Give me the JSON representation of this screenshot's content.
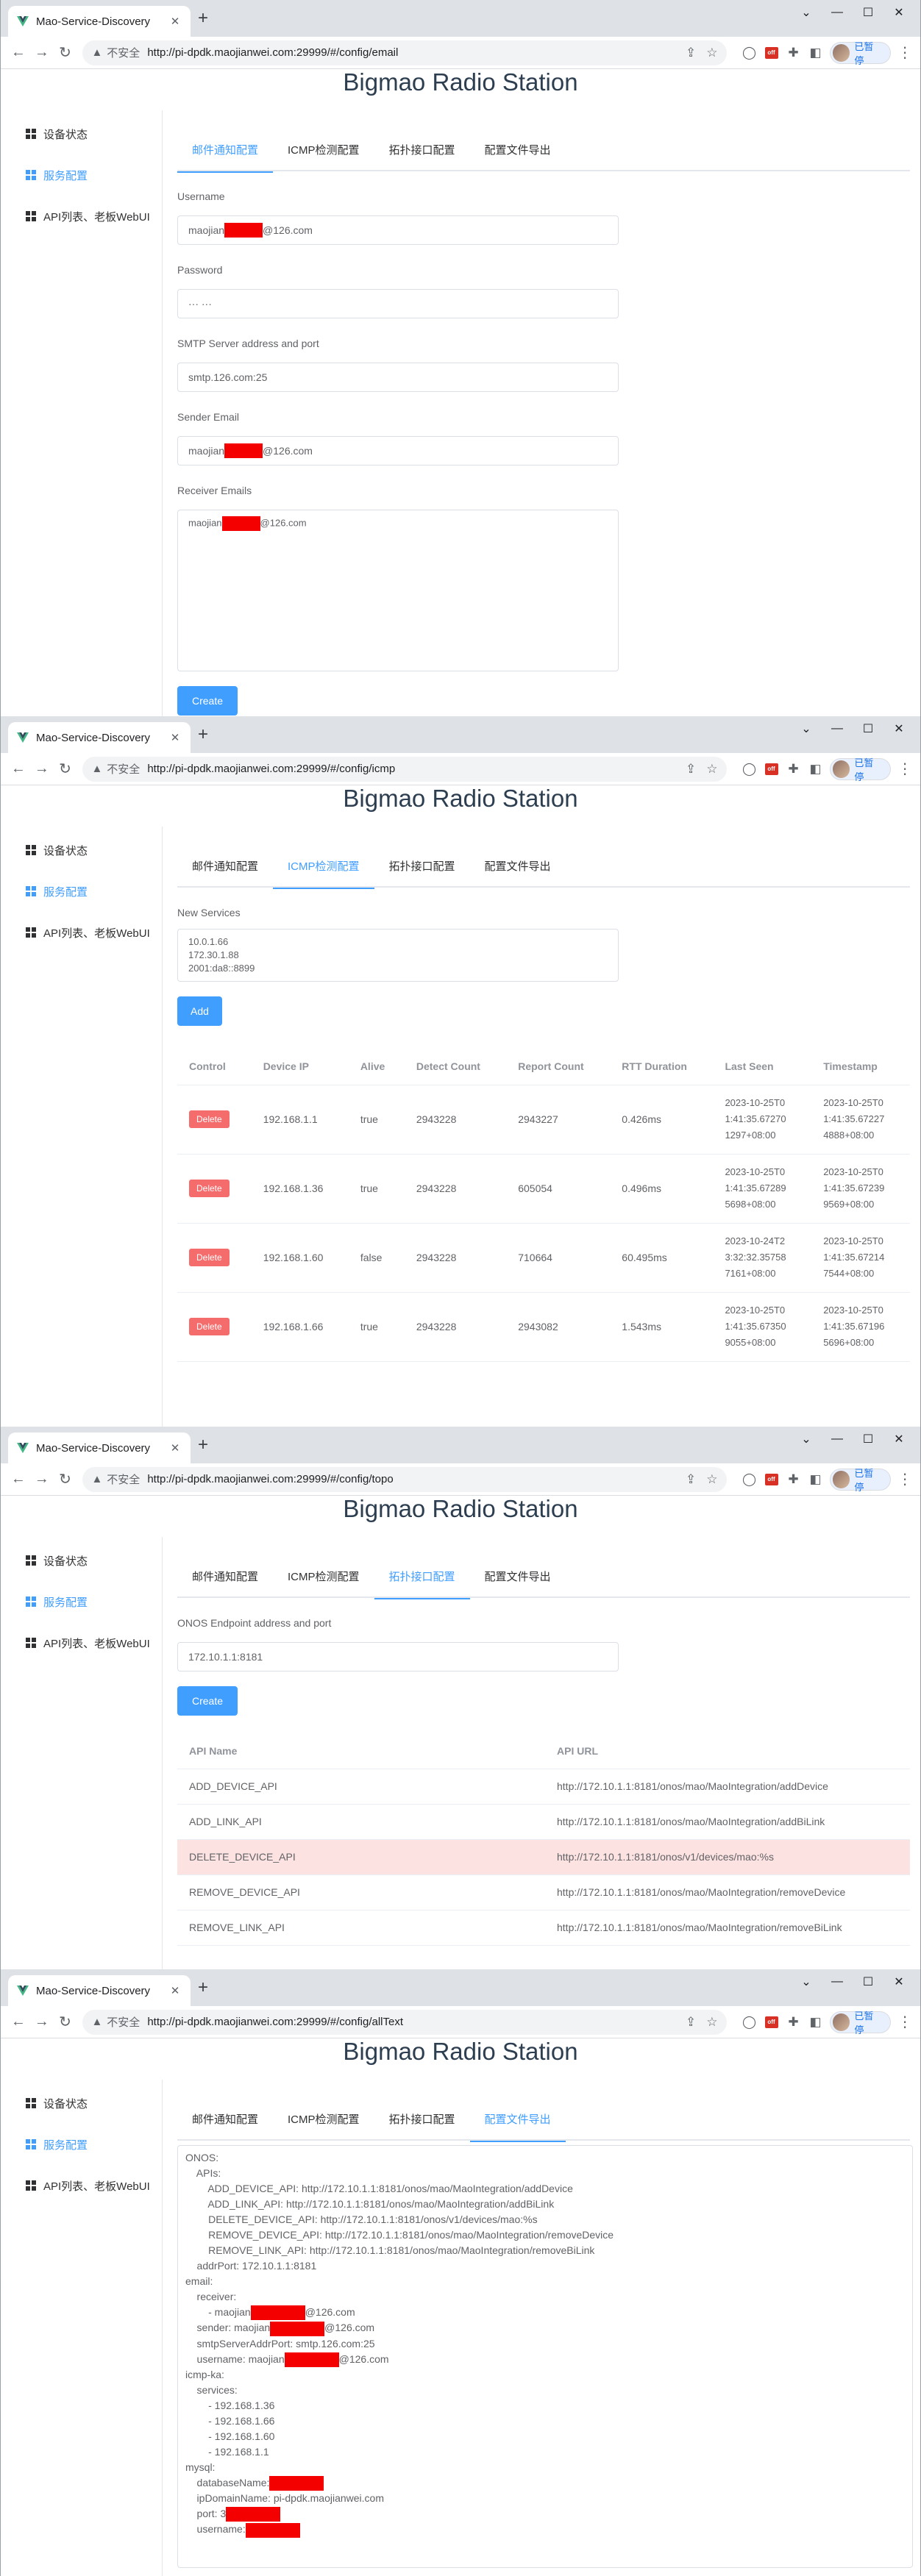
{
  "browser": {
    "tab_title": "Mao-Service-Discovery",
    "insecure_label": "不安全",
    "profile_label": "已暂停",
    "ext_badge": "off"
  },
  "app": {
    "title": "Bigmao Radio Station",
    "menu": [
      "设备状态",
      "服务配置",
      "API列表、老板WebUI"
    ],
    "tabs": [
      "邮件通知配置",
      "ICMP检测配置",
      "拓扑接口配置",
      "配置文件导出"
    ]
  },
  "screens": [
    {
      "url": "http://pi-dpdk.maojianwei.com:29999/#/config/email"
    },
    {
      "url": "http://pi-dpdk.maojianwei.com:29999/#/config/icmp"
    },
    {
      "url": "http://pi-dpdk.maojianwei.com:29999/#/config/topo"
    },
    {
      "url": "http://pi-dpdk.maojianwei.com:29999/#/config/allText"
    }
  ],
  "email": {
    "username_label": "Username",
    "username_prefix": "maojian",
    "username_suffix": "@126.com",
    "password_label": "Password",
    "password_value": "··· ···",
    "smtp_label": "SMTP Server address and port",
    "smtp_value": "smtp.126.com:25",
    "sender_label": "Sender Email",
    "sender_prefix": "maojian",
    "sender_suffix": "@126.com",
    "receivers_label": "Receiver Emails",
    "receivers_prefix": "maojian",
    "receivers_suffix": "@126.com",
    "create_label": "Create"
  },
  "icmp": {
    "new_services_label": "New Services",
    "services_text": "10.0.1.66\n172.30.1.88\n2001:da8::8899",
    "add_label": "Add",
    "delete_label": "Delete",
    "columns": [
      "Control",
      "Device IP",
      "Alive",
      "Detect Count",
      "Report Count",
      "RTT Duration",
      "Last Seen",
      "Timestamp"
    ],
    "rows": [
      {
        "ip": "192.168.1.1",
        "alive": "true",
        "detect": "2943228",
        "report": "2943227",
        "rtt": "0.426ms",
        "last_seen": "2023-10-25T0\n1:41:35.67270\n1297+08:00",
        "timestamp": "2023-10-25T0\n1:41:35.67227\n4888+08:00"
      },
      {
        "ip": "192.168.1.36",
        "alive": "true",
        "detect": "2943228",
        "report": "605054",
        "rtt": "0.496ms",
        "last_seen": "2023-10-25T0\n1:41:35.67289\n5698+08:00",
        "timestamp": "2023-10-25T0\n1:41:35.67239\n9569+08:00"
      },
      {
        "ip": "192.168.1.60",
        "alive": "false",
        "detect": "2943228",
        "report": "710664",
        "rtt": "60.495ms",
        "last_seen": "2023-10-24T2\n3:32:32.35758\n7161+08:00",
        "timestamp": "2023-10-25T0\n1:41:35.67214\n7544+08:00"
      },
      {
        "ip": "192.168.1.66",
        "alive": "true",
        "detect": "2943228",
        "report": "2943082",
        "rtt": "1.543ms",
        "last_seen": "2023-10-25T0\n1:41:35.67350\n9055+08:00",
        "timestamp": "2023-10-25T0\n1:41:35.67196\n5696+08:00"
      }
    ]
  },
  "topo": {
    "endpoint_label": "ONOS Endpoint address and port",
    "endpoint_value": "172.10.1.1:8181",
    "create_label": "Create",
    "columns": [
      "API Name",
      "API URL"
    ],
    "rows": [
      {
        "name": "ADD_DEVICE_API",
        "url": "http://172.10.1.1:8181/onos/mao/MaoIntegration/addDevice"
      },
      {
        "name": "ADD_LINK_API",
        "url": "http://172.10.1.1:8181/onos/mao/MaoIntegration/addBiLink"
      },
      {
        "name": "DELETE_DEVICE_API",
        "url": "http://172.10.1.1:8181/onos/v1/devices/mao:%s"
      },
      {
        "name": "REMOVE_DEVICE_API",
        "url": "http://172.10.1.1:8181/onos/mao/MaoIntegration/removeDevice"
      },
      {
        "name": "REMOVE_LINK_API",
        "url": "http://172.10.1.1:8181/onos/mao/MaoIntegration/removeBiLink"
      }
    ]
  },
  "export": {
    "lines": [
      {
        "t": "ONOS:"
      },
      {
        "t": "    APIs:"
      },
      {
        "t": "        ADD_DEVICE_API: http://172.10.1.1:8181/onos/mao/MaoIntegration/addDevice"
      },
      {
        "t": "        ADD_LINK_API: http://172.10.1.1:8181/onos/mao/MaoIntegration/addBiLink"
      },
      {
        "t": "        DELETE_DEVICE_API: http://172.10.1.1:8181/onos/v1/devices/mao:%s"
      },
      {
        "t": "        REMOVE_DEVICE_API: http://172.10.1.1:8181/onos/mao/MaoIntegration/removeDevice"
      },
      {
        "t": "        REMOVE_LINK_API: http://172.10.1.1:8181/onos/mao/MaoIntegration/removeBiLink"
      },
      {
        "t": "    addrPort: 172.10.1.1:8181"
      },
      {
        "t": "email:"
      },
      {
        "t": "    receiver:"
      },
      {
        "t": "        - maojian",
        "r": true,
        "a": "@126.com"
      },
      {
        "t": "    sender: maojian",
        "r": true,
        "a": "@126.com"
      },
      {
        "t": "    smtpServerAddrPort: smtp.126.com:25"
      },
      {
        "t": "    username: maojian",
        "r": true,
        "a": "@126.com"
      },
      {
        "t": "icmp-ka:"
      },
      {
        "t": "    services:"
      },
      {
        "t": "        - 192.168.1.36"
      },
      {
        "t": "        - 192.168.1.66"
      },
      {
        "t": "        - 192.168.1.60"
      },
      {
        "t": "        - 192.168.1.1"
      },
      {
        "t": "mysql:"
      },
      {
        "t": "    databaseName:",
        "r": true
      },
      {
        "t": "    ipDomainName: pi-dpdk.maojianwei.com"
      },
      {
        "t": "    port: 3",
        "r": true
      },
      {
        "t": "    username:",
        "r": true
      }
    ]
  },
  "colors": {
    "accent": "#409eff",
    "danger": "#f56c6c",
    "redact": "#f50000",
    "highlight_row": "#fde2e2"
  }
}
